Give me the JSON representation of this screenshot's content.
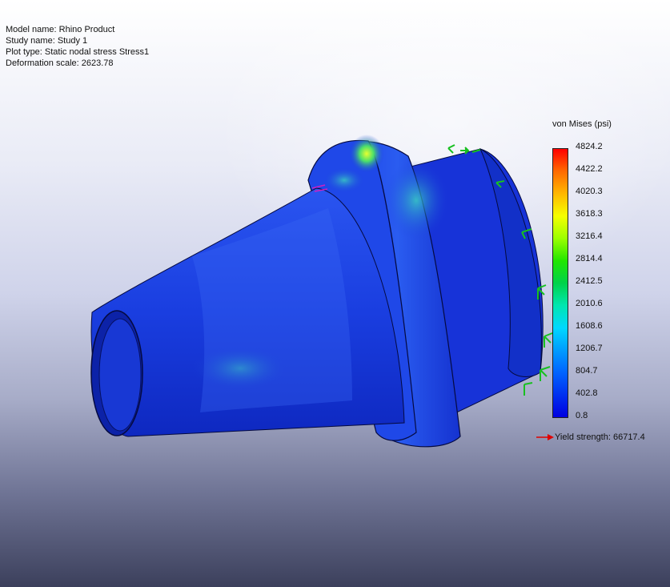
{
  "info": {
    "model_name": "Model name: Rhino Product",
    "study_name": "Study name: Study 1",
    "plot_type": "Plot type: Static nodal stress Stress1",
    "deformation_scale": "Deformation scale: 2623.78"
  },
  "legend": {
    "title": "von Mises (psi)",
    "values": [
      "4824.2",
      "4422.2",
      "4020.3",
      "3618.3",
      "3216.4",
      "2814.4",
      "2412.5",
      "2010.6",
      "1608.6",
      "1206.7",
      "804.7",
      "402.8",
      "0.8"
    ],
    "colors": [
      "#ff0000",
      "#ff6a00",
      "#ffb800",
      "#f5ff00",
      "#9cff00",
      "#22e600",
      "#00d24a",
      "#00e6b0",
      "#00d8ff",
      "#009cff",
      "#0064ff",
      "#0030f0",
      "#0000e0"
    ]
  },
  "yield": {
    "label": "Yield strength: 66717.4",
    "arrow_color": "#e00000"
  },
  "model_colors": {
    "body": "#1a3ee0",
    "body_dark": "#0b1fb0",
    "highlight_green": "#3ad27a",
    "fixture_green": "#18c021"
  }
}
